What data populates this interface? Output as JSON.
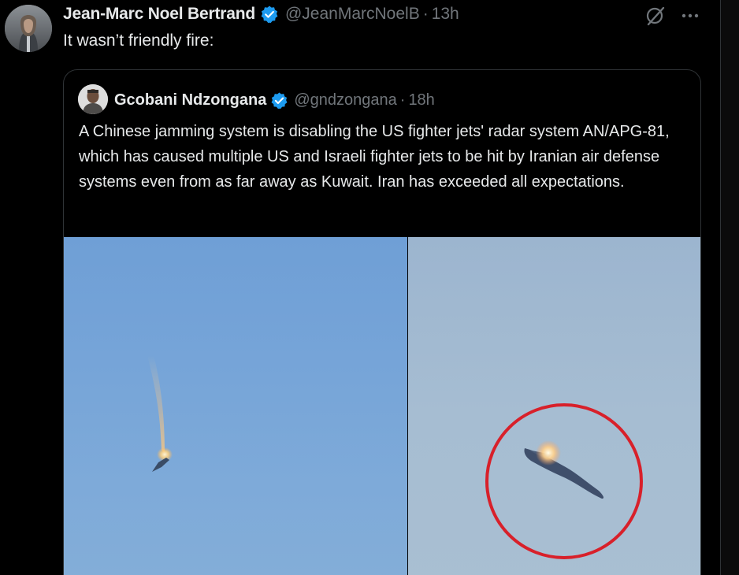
{
  "tweet": {
    "author_name": "Jean-Marc Noel Bertrand",
    "author_handle": "@JeanMarcNoelB",
    "separator": "·",
    "time": "13h",
    "text": "It wasn’t friendly fire:",
    "icons": {
      "verified": "verified-badge-icon",
      "grok": "grok-icon",
      "more": "more-icon"
    }
  },
  "quote": {
    "author_name": "Gcobani Ndzongana",
    "author_handle": "@gndzongana",
    "separator": "·",
    "time": "18h",
    "text": "A Chinese jamming system is disabling the US fighter jets' radar system AN/APG-81, which has caused multiple US and Israeli fighter jets to be hit by Iranian air defense systems even from as far away as Kuwait. Iran has exceeded all expectations."
  },
  "colors": {
    "background": "#000000",
    "text_primary": "#e7e9ea",
    "text_secondary": "#71767b",
    "verified_blue": "#1d9bf0",
    "border": "#2f3336",
    "highlight_circle": "#d8202a"
  }
}
